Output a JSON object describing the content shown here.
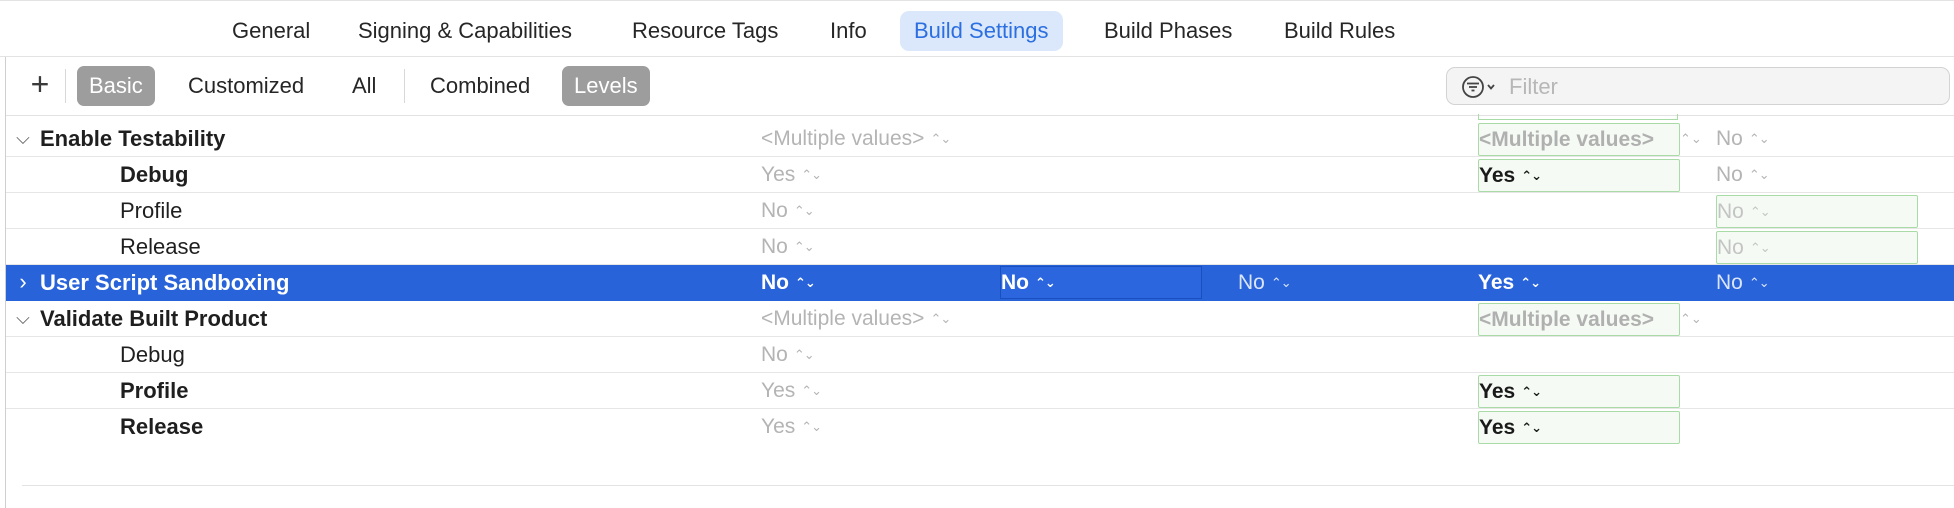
{
  "tabs": [
    {
      "label": "General",
      "active": false
    },
    {
      "label": "Signing & Capabilities",
      "active": false
    },
    {
      "label": "Resource Tags",
      "active": false
    },
    {
      "label": "Info",
      "active": false
    },
    {
      "label": "Build Settings",
      "active": true
    },
    {
      "label": "Build Phases",
      "active": false
    },
    {
      "label": "Build Rules",
      "active": false
    }
  ],
  "toolbar": {
    "add_label": "+",
    "scope": [
      {
        "label": "Basic",
        "selected": true
      },
      {
        "label": "Customized",
        "selected": false
      },
      {
        "label": "All",
        "selected": false
      }
    ],
    "view": [
      {
        "label": "Combined",
        "selected": false
      },
      {
        "label": "Levels",
        "selected": true
      }
    ],
    "filter_placeholder": "Filter",
    "filter_icon": "filter-circle-icon"
  },
  "rows": [
    {
      "name": "Enable Testability",
      "expanded": true,
      "cells": {
        "resolved": "<Multiple values>",
        "target": "<Multiple values>",
        "default": "No"
      }
    },
    {
      "name": "Debug",
      "cells": {
        "resolved": "Yes",
        "target": "Yes",
        "default": "No"
      }
    },
    {
      "name": "Profile",
      "cells": {
        "resolved": "No",
        "default": "No"
      }
    },
    {
      "name": "Release",
      "cells": {
        "resolved": "No",
        "default": "No"
      }
    },
    {
      "name": "User Script Sandboxing",
      "expanded": false,
      "cells": {
        "resolved": "No",
        "target": "No",
        "project": "No",
        "config": "Yes",
        "default": "No"
      }
    },
    {
      "name": "Validate Built Product",
      "expanded": true,
      "cells": {
        "resolved": "<Multiple values>",
        "target": "<Multiple values>"
      }
    },
    {
      "name": "Debug",
      "cells": {
        "resolved": "No"
      }
    },
    {
      "name": "Profile",
      "cells": {
        "resolved": "Yes",
        "target": "Yes"
      }
    },
    {
      "name": "Release",
      "cells": {
        "resolved": "Yes",
        "target": "Yes"
      }
    }
  ],
  "colors": {
    "selection": "#2963d9",
    "tab_active_bg": "#dbe8fb",
    "tab_active_fg": "#2c6fe0",
    "segment_on": "#9d9d9d",
    "override_box": "#a8dba5"
  }
}
